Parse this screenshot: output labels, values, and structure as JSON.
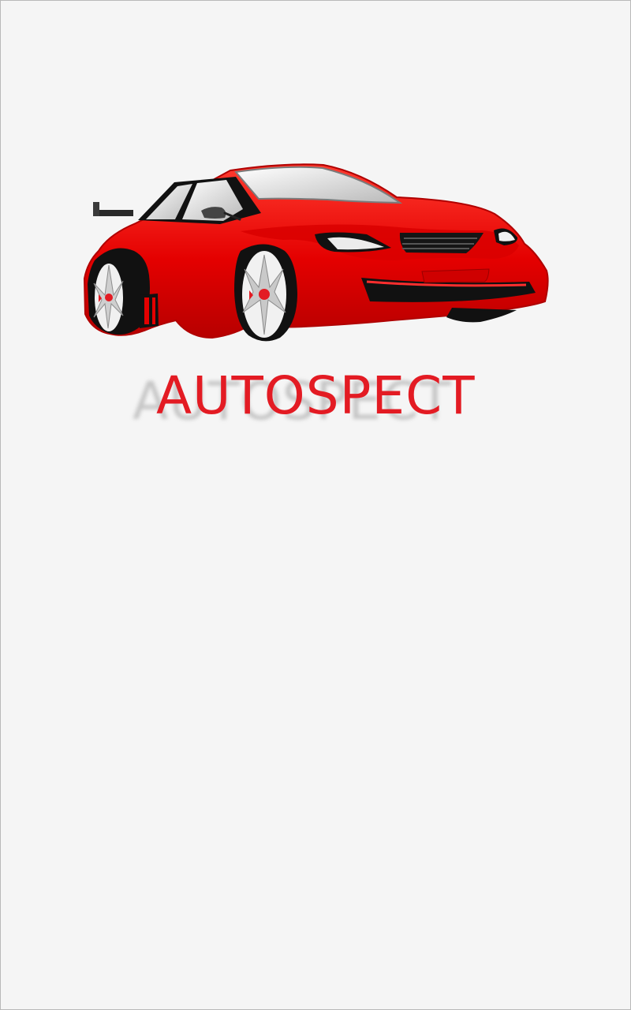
{
  "app": {
    "brand_name": "AUTOSPECT"
  },
  "splash": {
    "logo_icon": "red-sports-car-icon"
  },
  "colors": {
    "background": "#f5f5f5",
    "brand_red": "#e31b23",
    "car_red": "#ea0000",
    "dark": "#111111",
    "glass": "#d9d9d9",
    "wheel": "#f2f2f2"
  }
}
